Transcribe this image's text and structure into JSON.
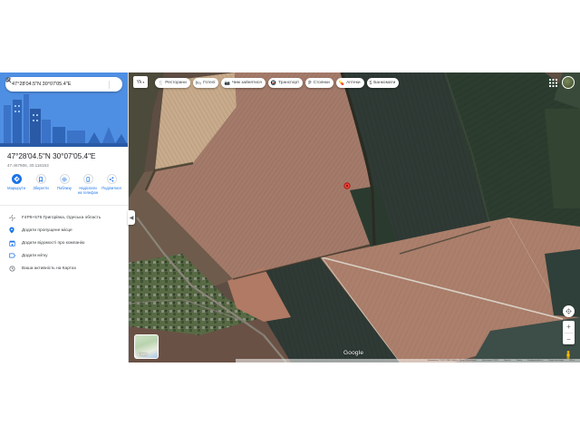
{
  "search": {
    "value": "47°28'04.5\"N 30°07'05.4\"E"
  },
  "place": {
    "title": "47°28'04.5\"N 30°07'05.4\"E",
    "decimal": "47.467906, 30.118153"
  },
  "actions": [
    {
      "label": "Маршрути",
      "icon": "directions-icon"
    },
    {
      "label": "Зберегти",
      "icon": "bookmark-icon"
    },
    {
      "label": "Поблизу",
      "icon": "nearby-icon"
    },
    {
      "label": "Надіслати на телефон",
      "label_line1": "Надіслати",
      "label_line2": "на телефон",
      "icon": "send-to-phone-icon"
    },
    {
      "label": "Поділитися",
      "icon": "share-icon"
    }
  ],
  "info_rows": [
    {
      "text": "F4P8+576 Григорівка, Одеська область",
      "icon": "plus-code-icon"
    },
    {
      "text": "Додати пропущене місце",
      "icon": "add-place-icon"
    },
    {
      "text": "Додати відомості про компанію",
      "icon": "business-icon"
    },
    {
      "text": "Додати мітку",
      "icon": "label-icon"
    },
    {
      "text": "Ваша активність на Картах",
      "icon": "history-icon"
    }
  ],
  "language_selector": {
    "value": "Yk"
  },
  "chips": [
    {
      "label": "Ресторани",
      "icon": "restaurant-icon"
    },
    {
      "label": "Готелі",
      "icon": "hotel-icon"
    },
    {
      "label": "Чим зайнятися",
      "icon": "camera-icon"
    },
    {
      "label": "Транспорт",
      "icon": "transit-icon"
    },
    {
      "label": "Стоянки",
      "icon": "parking-icon"
    },
    {
      "label": "Аптеки",
      "icon": "pharmacy-icon"
    },
    {
      "label": "Банкомати",
      "icon": "atm-icon"
    }
  ],
  "map": {
    "layers_label": "Шари",
    "logo": "Google",
    "zoom_in": "+",
    "zoom_out": "−",
    "collapse_glyph": "◀",
    "footer": [
      "Зображення ©2022 CNES / Airbus, Maxar Technologies",
      "Дані карти ©2022",
      "Україна",
      "Умови",
      "Конфіденційність",
      "Надіслати відгук",
      "500 м"
    ],
    "marker_color": "#ea4335"
  },
  "colors": {
    "accent": "#1a73e8",
    "panel_bg": "#ffffff",
    "text_primary": "#202124",
    "text_secondary": "#70757a"
  }
}
